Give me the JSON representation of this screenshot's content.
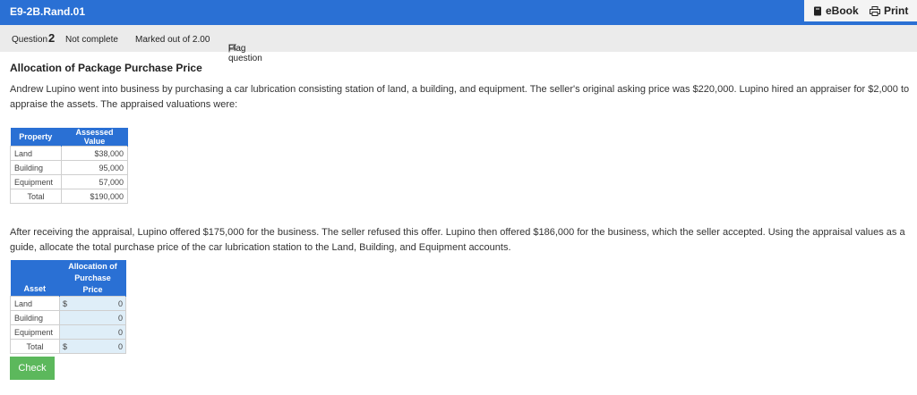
{
  "topbar": {
    "title": "E9-2B.Rand.01",
    "ebook_label": "eBook",
    "print_label": "Print"
  },
  "question_bar": {
    "question_prefix": "Question",
    "question_number": "2",
    "status": "Not complete",
    "marked": "Marked out of 2.00",
    "flag_label": "Flag question"
  },
  "heading": "Allocation of Package Purchase Price",
  "paragraph1": "Andrew Lupino went into business by purchasing a car lubrication consisting station of land, a building, and equipment. The seller's original asking price was $220,000. Lupino hired an appraiser for $2,000 to appraise the assets. The appraised valuations were:",
  "appraisal_table": {
    "headers": [
      "Property",
      "Assessed Value"
    ],
    "rows": [
      {
        "label": "Land",
        "value": "$38,000"
      },
      {
        "label": "Building",
        "value": "95,000"
      },
      {
        "label": "Equipment",
        "value": "57,000"
      },
      {
        "label": "Total",
        "value": "$190,000"
      }
    ]
  },
  "paragraph2": "After receiving the appraisal, Lupino offered $175,000 for the business. The seller refused this offer. Lupino then offered $186,000 for the business, which the seller accepted. Using the appraisal values as a guide, allocate the total purchase price of the car lubrication station to the Land, Building, and Equipment accounts.",
  "allocation_table": {
    "header_asset": "Asset",
    "header_line1": "Allocation of",
    "header_line2": "Purchase Price",
    "rows": [
      {
        "label": "Land",
        "prefix": "$",
        "value": "0"
      },
      {
        "label": "Building",
        "prefix": "",
        "value": "0"
      },
      {
        "label": "Equipment",
        "prefix": "",
        "value": "0"
      },
      {
        "label": "Total",
        "prefix": "$",
        "value": "0"
      }
    ]
  },
  "check_label": "Check",
  "colors": {
    "header_blue": "#2a70d4",
    "input_bg": "#dfeef8",
    "check_green": "#5cb85c"
  },
  "icons": {
    "ebook": "book-icon",
    "print": "printer-icon",
    "flag": "flag-icon"
  }
}
